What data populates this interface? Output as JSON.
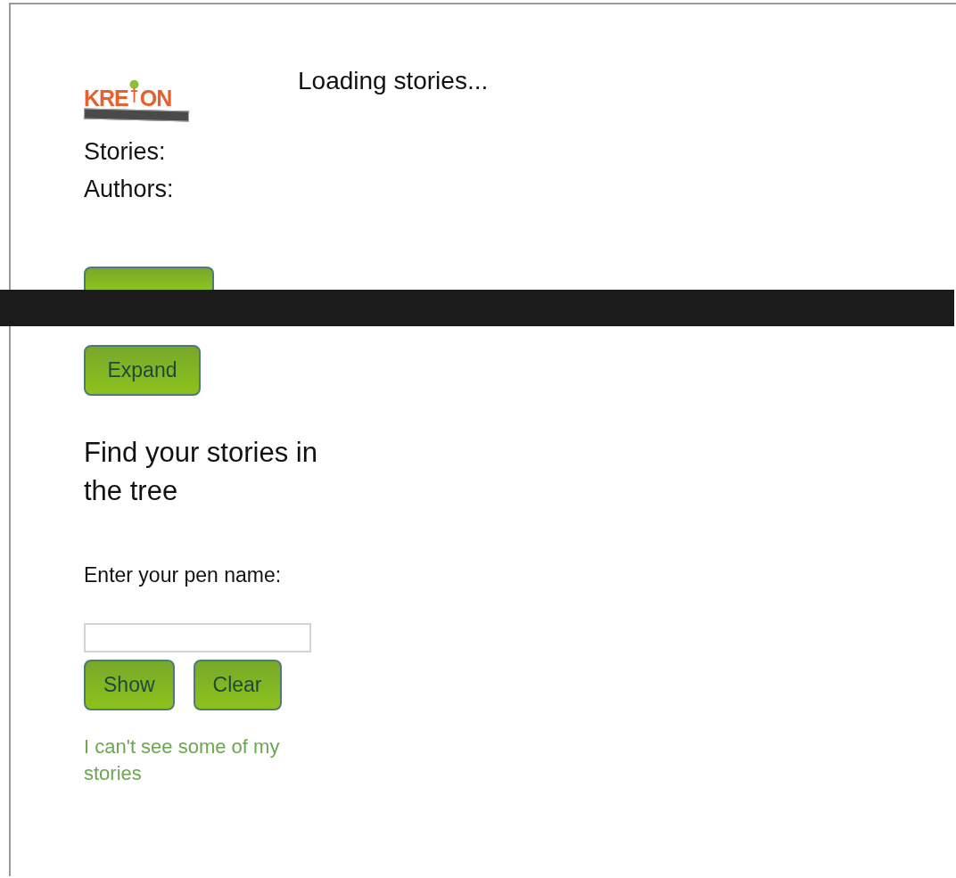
{
  "logo": {
    "text_left": "KRE",
    "text_right": "ON"
  },
  "status": "Loading stories...",
  "counts": [
    {
      "label": "Stories:"
    },
    {
      "label": "Authors:"
    }
  ],
  "tree_buttons": [
    {
      "covered": true
    },
    {
      "label": "Expand",
      "covered": false
    }
  ],
  "redaction": {
    "kind": "bar"
  },
  "heading": "Find your stories in the tree",
  "pen_name": {
    "label": "Enter your pen name:"
  },
  "buttons": [
    {
      "label": "Show"
    },
    {
      "label": "Clear"
    }
  ],
  "help_link": "I can't see some of my stories"
}
